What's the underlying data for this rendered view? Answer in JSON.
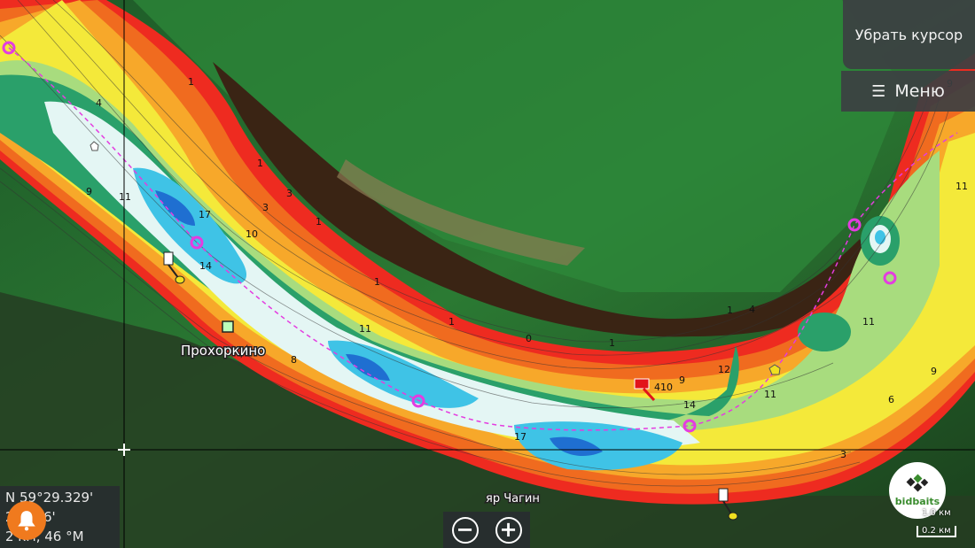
{
  "buttons": {
    "remove_cursor": "Убрать курсор",
    "menu": "Меню",
    "zoom_out": "−",
    "zoom_in": "+"
  },
  "coords": {
    "line1": "N  59°29.329'",
    "line2": "     23.336'",
    "line3": "2   км, 46 °M"
  },
  "places": {
    "village": "Прохоркино",
    "bank": "яр Чагин"
  },
  "depth_labels": [
    "1",
    "1",
    "3",
    "1",
    "1",
    "1",
    "0",
    "1",
    "1",
    "11",
    "9",
    "9",
    "6",
    "3",
    "12",
    "14",
    "17",
    "17",
    "10",
    "11",
    "14",
    "8",
    "9",
    "11",
    "410",
    "11",
    "11",
    "9",
    "3",
    "4",
    "4"
  ],
  "scale": {
    "top": "1.0 км",
    "bottom": "0.2 км"
  },
  "logo_text": "bidbaits",
  "icons": [
    "menu-icon",
    "bell-icon",
    "zoom-out-icon",
    "zoom-in-icon",
    "crosshair-icon",
    "flag-icon",
    "waypoint-icon",
    "gps-target-icon"
  ],
  "colors": {
    "deep": "#1f6fd1",
    "mid": "#3fc3e6",
    "shallow": "#f4e93a",
    "shore": "#ee2b20",
    "track": "#e43ce0"
  }
}
